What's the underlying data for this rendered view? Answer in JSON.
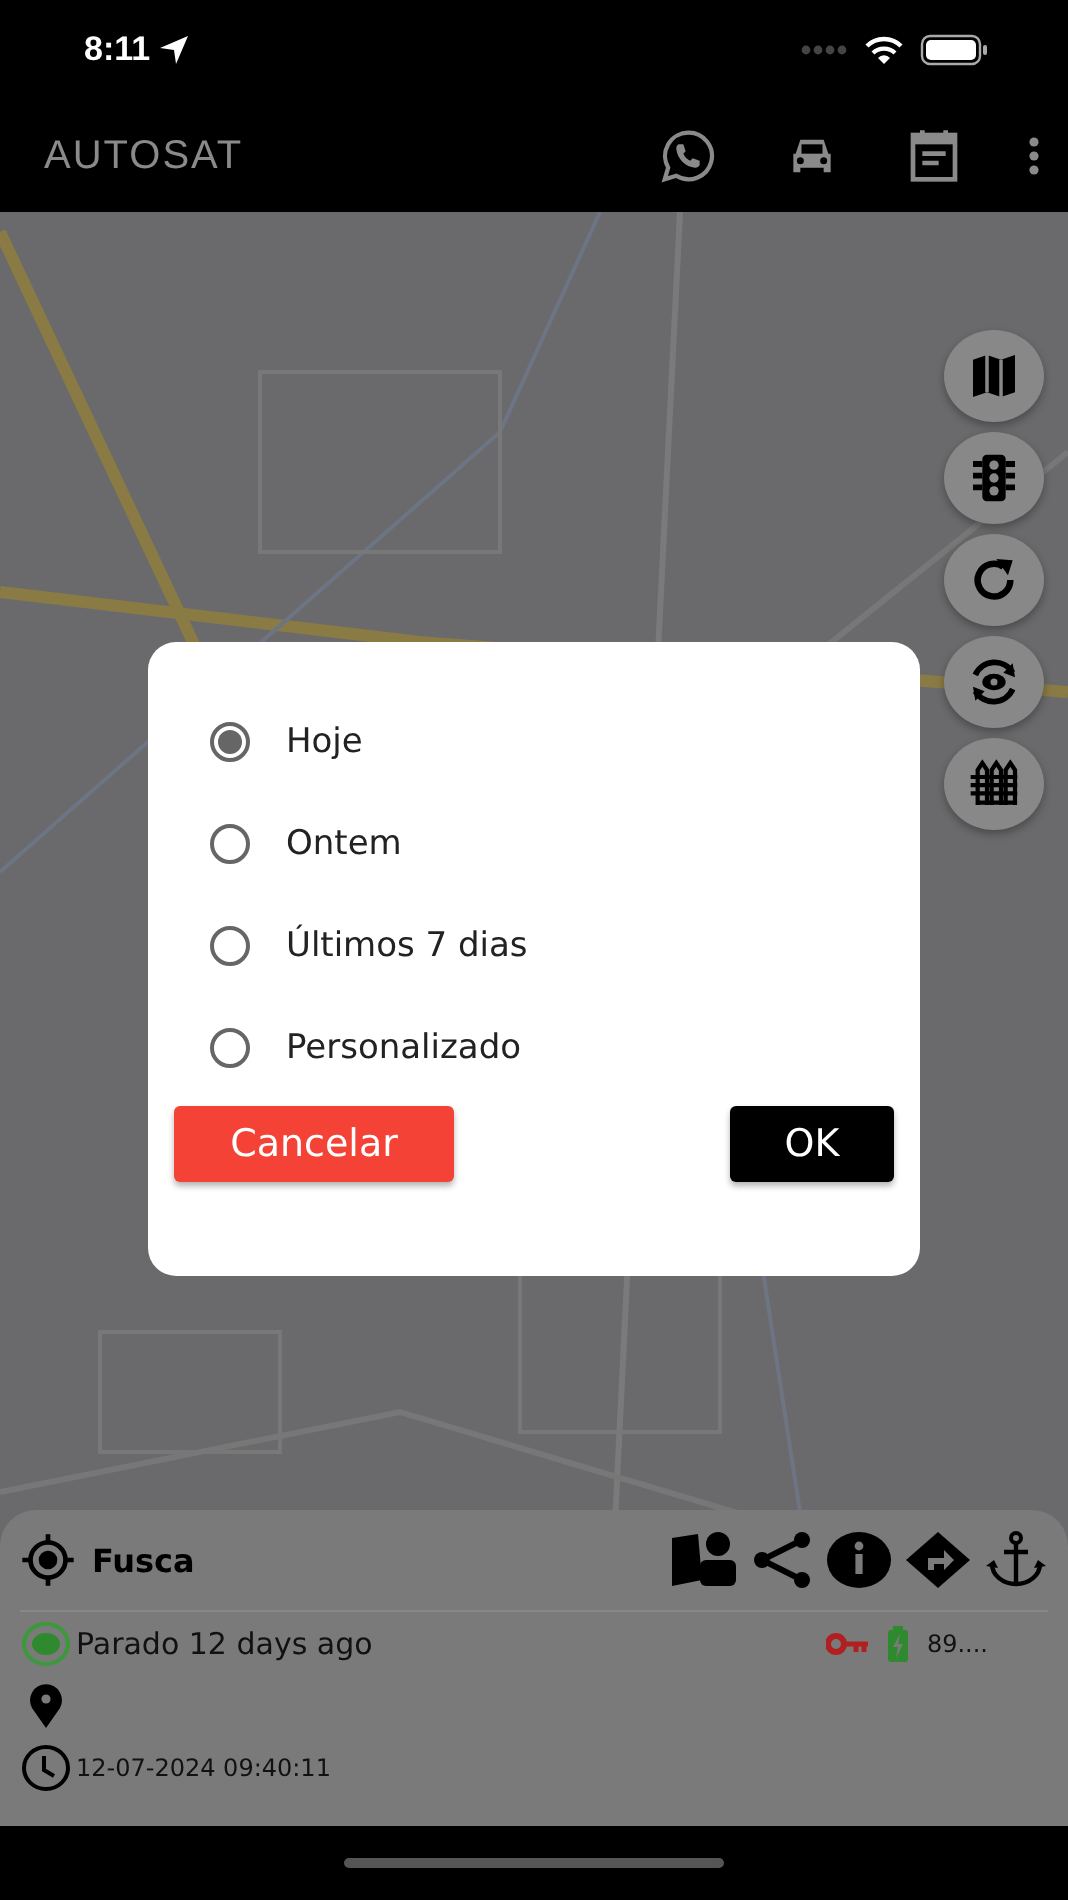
{
  "status_bar": {
    "time": "8:11"
  },
  "app_bar": {
    "title": "AUTOSAT"
  },
  "dialog": {
    "options": [
      {
        "label": "Hoje",
        "selected": true
      },
      {
        "label": "Ontem",
        "selected": false
      },
      {
        "label": "Últimos 7 dias",
        "selected": false
      },
      {
        "label": "Personalizado",
        "selected": false
      }
    ],
    "buttons": [
      {
        "label": "Cancelar",
        "kind": "cancel"
      },
      {
        "label": "OK",
        "kind": "confirm"
      }
    ]
  },
  "vehicle": {
    "name": "Fusca",
    "status": "Parado 12 days ago",
    "battery": "89....",
    "timestamp": "12-07-2024 09:40:11"
  }
}
